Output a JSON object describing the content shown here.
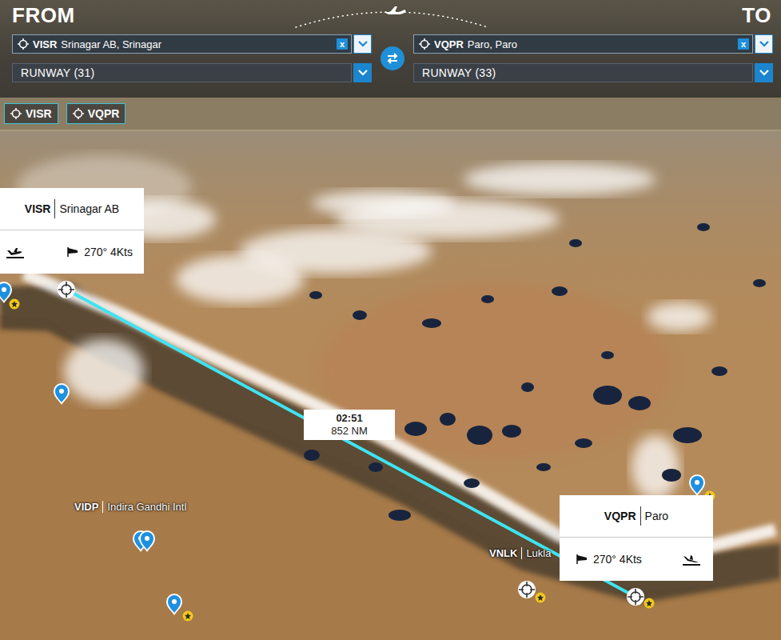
{
  "header": {
    "from_label": "FROM",
    "to_label": "TO"
  },
  "from": {
    "code": "VISR",
    "name": "Srinagar AB, Srinagar",
    "clear": "x",
    "runway": "RUNWAY (31)"
  },
  "to": {
    "code": "VQPR",
    "name": "Paro, Paro",
    "clear": "x",
    "runway": "RUNWAY (33)"
  },
  "quick_buttons": [
    {
      "label": "VISR"
    },
    {
      "label": "VQPR"
    }
  ],
  "map": {
    "route": {
      "time": "02:51",
      "distance": "852 NM"
    },
    "airport_cards": [
      {
        "code": "VISR",
        "name": "Srinagar AB",
        "wind": "270° 4Kts",
        "kind": "departure"
      },
      {
        "code": "VQPR",
        "name": "Paro",
        "wind": "270° 4Kts",
        "kind": "arrival"
      }
    ],
    "labels": [
      {
        "code": "VIDP",
        "name": "Indira Gandhi Intl"
      },
      {
        "code": "VNLK",
        "name": "Lukla"
      }
    ]
  }
}
